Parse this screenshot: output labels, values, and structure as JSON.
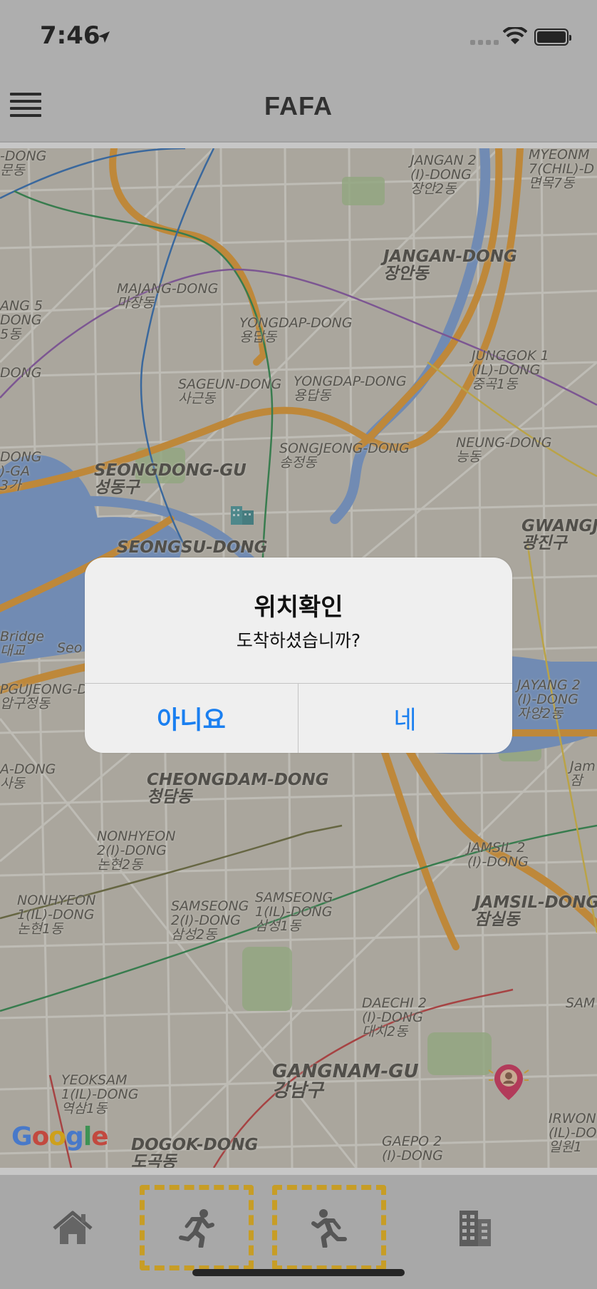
{
  "status_bar": {
    "time": "7:46"
  },
  "nav": {
    "title": "FAFA"
  },
  "map": {
    "labels": [
      "JANGAN 2\n(I)-DONG\n장안2동",
      "MYEONM\n7(CHIL)-D\n면목7동",
      "JANGAN-DONG\n장안동",
      "MAJANG-DONG\n마장동",
      "YONGDAP-DONG\n용답동",
      "SAGEUN-DONG\n사근동",
      "YONGDAP-DONG\n용답동",
      "JUNGGOK 1\n(IL)-DONG\n중곡1동",
      "SONGJEONG-DONG\n송정동",
      "NEUNG-DONG\n능동",
      "SEONGDONG-GU\n성동구",
      "GWANGJIN\n광진구",
      "SEONGSU-DONG",
      "Bridge\n대교",
      "PGUJEONG-D\n압구정동",
      "JAYANG 2\n(I)-DONG\n자양2동",
      "A-DONG\n사동",
      "CHEONGDAM-DONG\n청담동",
      "Jam\n잠",
      "NONHYEON\n2(I)-DONG\n논현2동",
      "JAMSIL 2\n(I)-DONG",
      "NONHYEON\n1(IL)-DONG\n논현1동",
      "SAMSEONG\n2(I)-DONG\n삼성2동",
      "SAMSEONG\n1(IL)-DONG\n삼성1동",
      "JAMSIL-DONG\n잠실동",
      "DAECHI 2\n(I)-DONG\n대치2동",
      "SAM",
      "GANGNAM-GU\n강남구",
      "YEOKSAM\n1(IL)-DONG\n역삼1동",
      "IRWON\n(IL)-DO\n일원1",
      "DOGOK-DONG\n도곡동",
      "GAEPO 2\n(I)-DONG",
      "ANG 5\nDONG\n5동",
      "DONG",
      "DONG\n)-GA\n3가",
      "-DONG\n문동",
      "Seo"
    ],
    "attribution": [
      "G",
      "o",
      "o",
      "g",
      "l",
      "e"
    ],
    "attribution_colors": [
      "#4285F4",
      "#EA4335",
      "#FBBC05",
      "#4285F4",
      "#34A853",
      "#EA4335"
    ]
  },
  "alert": {
    "title": "위치확인",
    "message": "도착하셨습니까?",
    "cancel_label": "아니요",
    "confirm_label": "네"
  },
  "tabs": [
    {
      "icon": "home-icon"
    },
    {
      "icon": "runner-icon",
      "highlighted": true
    },
    {
      "icon": "runner-alt-icon",
      "highlighted": true
    },
    {
      "icon": "building-icon"
    }
  ],
  "colors": {
    "accent": "#1a7ff0",
    "highlight": "#f2b713",
    "road_major": "#e59a2f",
    "water": "#7a9fd6"
  }
}
